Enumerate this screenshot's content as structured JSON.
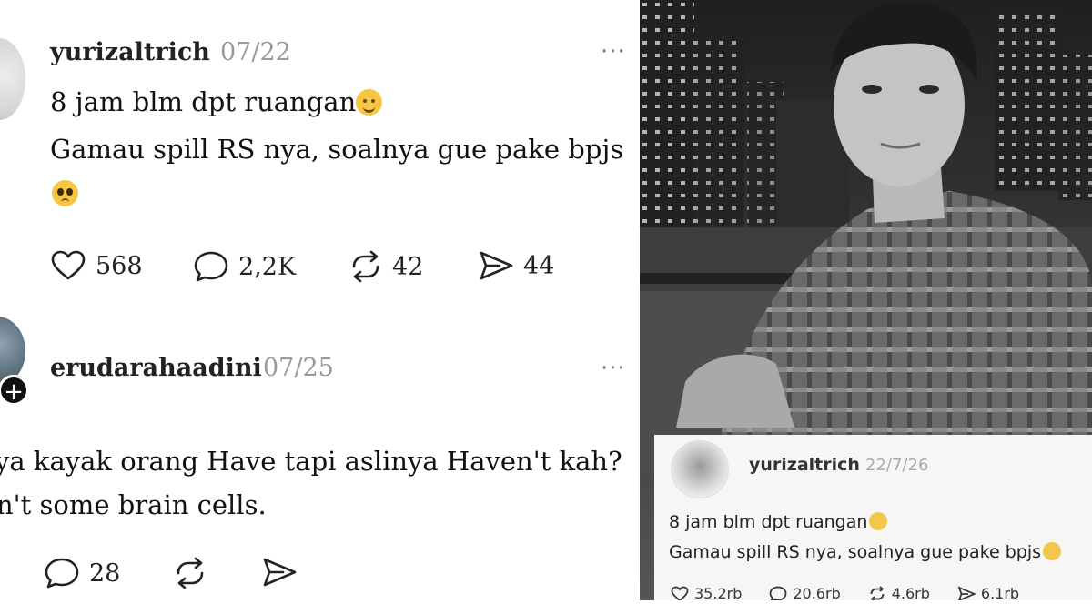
{
  "post1": {
    "username": "yurizaltrich",
    "date": "07/22",
    "more_icon": "more-dots-icon",
    "line1": "8 jam blm dpt ruangan",
    "line2": "Gamau spill RS nya, soalnya gue pake bpjs",
    "stats": {
      "likes": "568",
      "comments": "2,2K",
      "reposts": "42",
      "shares": "44"
    }
  },
  "post2": {
    "username": "erudarahaadini",
    "date": "07/25",
    "more_icon": "more-dots-icon",
    "line1": "ya kayak orang Have tapi aslinya Haven't kah?",
    "line2": "n't some brain cells.",
    "stats": {
      "comments": "28"
    }
  },
  "inset": {
    "username": "yurizaltrich",
    "date": "22/7/26",
    "line1": "8 jam blm dpt ruangan",
    "line2": "Gamau spill RS nya, soalnya gue pake bpjs",
    "stats": {
      "likes": "35.2rb",
      "comments": "20.6rb",
      "reposts": "4.6rb",
      "shares": "6.1rb"
    }
  },
  "colors": {
    "text": "#111111",
    "muted": "#9a9a9a",
    "emoji": "#f7c744"
  }
}
